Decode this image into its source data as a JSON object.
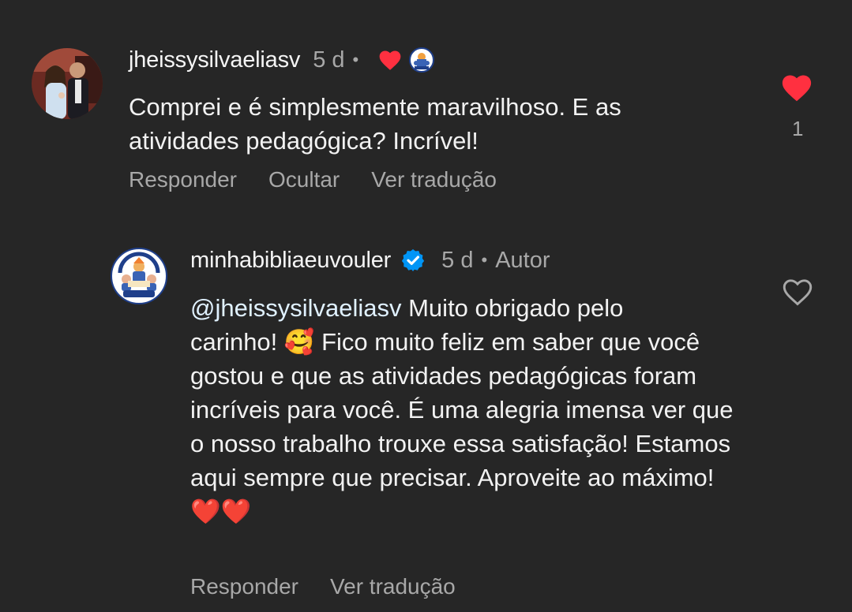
{
  "comments": [
    {
      "username": "jheissysilvaeliasv",
      "time": "5 d",
      "text": "Comprei e é simplesmente maravilhoso. E as atividades pedagógica? Incrível!",
      "actions": [
        "Responder",
        "Ocultar",
        "Ver tradução"
      ],
      "liked": true,
      "like_count": "1"
    },
    {
      "username": "minhabibliaeuvouler",
      "verified": true,
      "time": "5 d",
      "author_badge": "Autor",
      "mention": "@jheissysilvaeliasv",
      "text_line1": " Muito obrigado pelo",
      "text_rest": "carinho! 🥰 Fico muito feliz em saber que você gostou e que as atividades pedagógicas foram incríveis para você. É uma alegria imensa ver que o nosso trabalho trouxe essa satisfação! Estamos aqui sempre que precisar. Aproveite ao máximo!❤️❤️",
      "actions": [
        "Responder",
        "Ver tradução"
      ],
      "liked": false
    }
  ],
  "colors": {
    "background": "#262626",
    "text": "#f2f2f2",
    "muted": "#a8a8a8",
    "like_red": "#ff3040",
    "verified_blue": "#0095f6"
  }
}
